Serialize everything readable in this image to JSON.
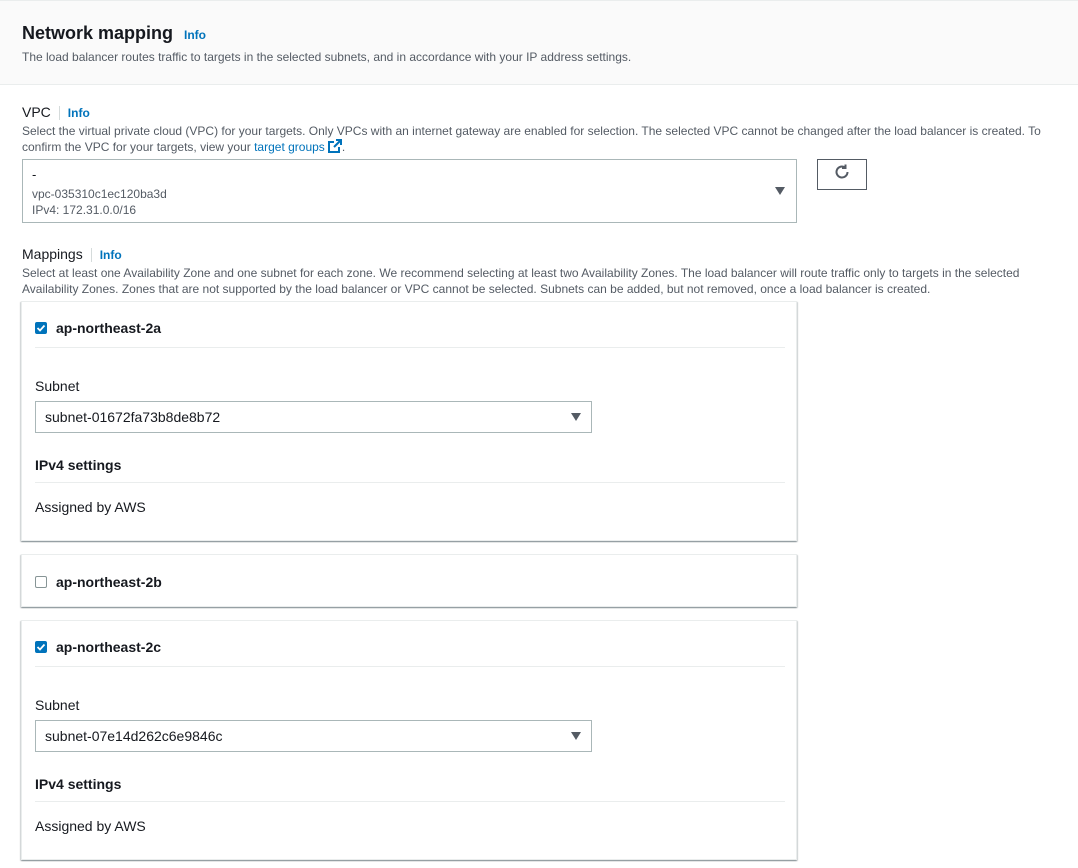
{
  "section": {
    "title": "Network mapping",
    "info": "Info",
    "description": "The load balancer routes traffic to targets in the selected subnets, and in accordance with your IP address settings."
  },
  "vpc": {
    "label": "VPC",
    "info": "Info",
    "description_prefix": "Select the virtual private cloud (VPC) for your targets. Only VPCs with an internet gateway are enabled for selection. The selected VPC cannot be changed after the load balancer is created. To confirm the VPC for your targets, view your ",
    "link_text": "target groups",
    "description_suffix": ".",
    "selected_name": "-",
    "selected_id": "vpc-035310c1ec120ba3d",
    "selected_cidr": "IPv4: 172.31.0.0/16",
    "refresh_icon": "refresh-icon"
  },
  "mappings": {
    "label": "Mappings",
    "info": "Info",
    "description": "Select at least one Availability Zone and one subnet for each zone. We recommend selecting at least two Availability Zones. The load balancer will route traffic only to targets in the selected Availability Zones. Zones that are not supported by the load balancer or VPC cannot be selected. Subnets can be added, but not removed, once a load balancer is created.",
    "zones": [
      {
        "name": "ap-northeast-2a",
        "checked": true,
        "subnet_label": "Subnet",
        "subnet_value": "subnet-01672fa73b8de8b72",
        "ipv4_title": "IPv4 settings",
        "ipv4_value": "Assigned by AWS"
      },
      {
        "name": "ap-northeast-2b",
        "checked": false
      },
      {
        "name": "ap-northeast-2c",
        "checked": true,
        "subnet_label": "Subnet",
        "subnet_value": "subnet-07e14d262c6e9846c",
        "ipv4_title": "IPv4 settings",
        "ipv4_value": "Assigned by AWS"
      }
    ]
  },
  "colors": {
    "link": "#0073bb",
    "checkbox_checked": "#0073bb",
    "text": "#16191f",
    "muted": "#545b64"
  }
}
